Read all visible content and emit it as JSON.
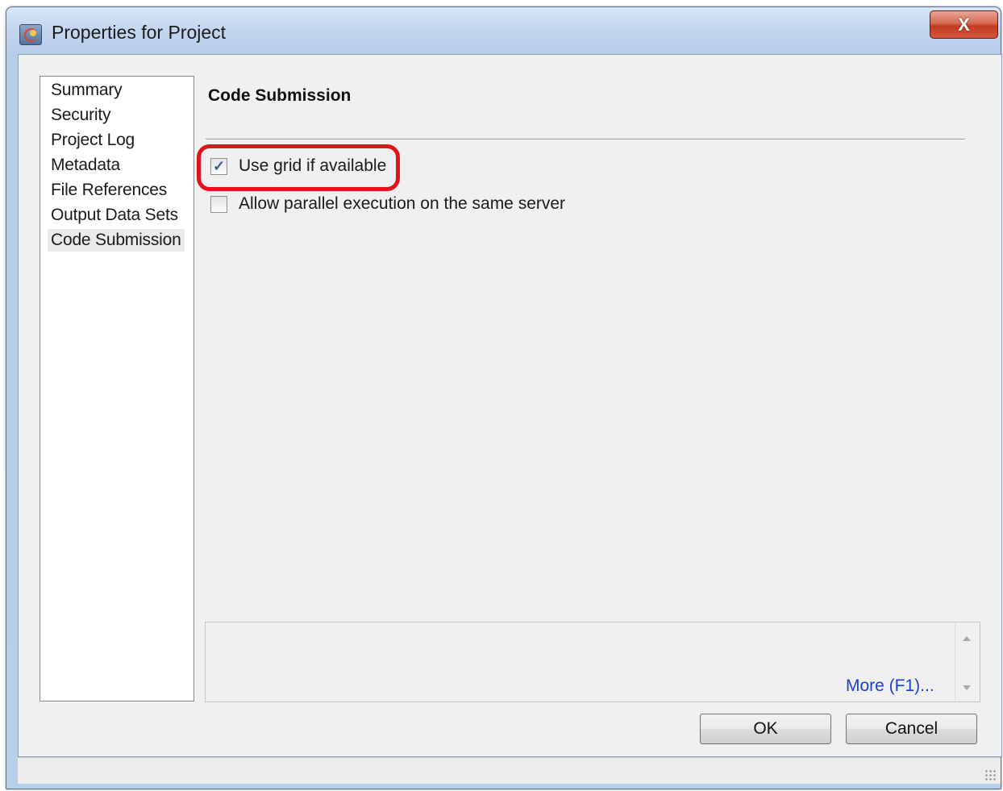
{
  "window": {
    "title": "Properties for Project",
    "close_label": "X"
  },
  "sidebar": {
    "items": [
      {
        "label": "Summary"
      },
      {
        "label": "Security"
      },
      {
        "label": "Project Log"
      },
      {
        "label": "Metadata"
      },
      {
        "label": "File References"
      },
      {
        "label": "Output Data Sets"
      },
      {
        "label": "Code Submission",
        "selected": true
      }
    ]
  },
  "main": {
    "section_title": "Code Submission",
    "options": [
      {
        "label": "Use grid if available",
        "checked": true
      },
      {
        "label": "Allow parallel execution on the same server",
        "checked": false
      }
    ],
    "help_link": "More (F1)..."
  },
  "buttons": {
    "ok": "OK",
    "cancel": "Cancel"
  },
  "colors": {
    "highlight": "#e0141c",
    "link": "#1c3fd4"
  },
  "icons": {
    "app": "project-properties-icon",
    "close": "close-icon",
    "scroll_up": "scroll-up-arrow-icon",
    "scroll_down": "scroll-down-arrow-icon",
    "grip": "resize-grip-icon"
  }
}
